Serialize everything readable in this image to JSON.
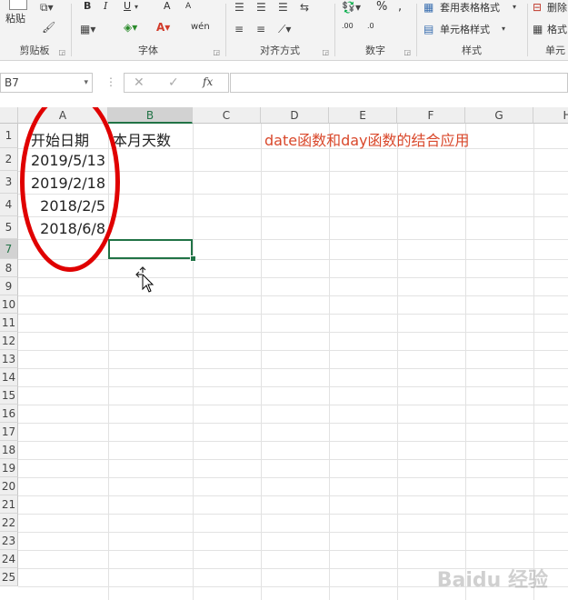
{
  "ribbon": {
    "clipboard": {
      "paste_label": "粘贴",
      "group_label": "剪贴板"
    },
    "font": {
      "bold": "B",
      "italic": "I",
      "underline": "U",
      "grow": "A",
      "shrink": "A",
      "wen": "wén",
      "group_label": "字体"
    },
    "alignment": {
      "group_label": "对齐方式"
    },
    "number": {
      "percent": "%",
      "comma": ",",
      "inc_decimal": ".00",
      "dec_decimal": ".0",
      "group_label": "数字"
    },
    "styles": {
      "table_format": "套用表格格式",
      "cell_styles": "单元格样式",
      "group_label": "样式"
    },
    "cells": {
      "delete_label": "删除",
      "format_label": "格式",
      "group_label": "单元"
    }
  },
  "formula_bar": {
    "name_box": "B7",
    "fx": "fx",
    "formula": ""
  },
  "columns": [
    "A",
    "B",
    "C",
    "D",
    "E",
    "F",
    "G",
    "H"
  ],
  "rows": [
    "1",
    "2",
    "3",
    "4",
    "5",
    "7",
    "8",
    "9",
    "10",
    "11",
    "12",
    "13",
    "14",
    "15",
    "16",
    "17",
    "18",
    "19",
    "20",
    "21",
    "22",
    "23",
    "24",
    "25"
  ],
  "cells": {
    "A1": "开始日期",
    "B1": "本月天数",
    "D1": "date函数和day函数的结合应用",
    "A2": "2019/5/13",
    "A3": "2019/2/18",
    "A4": "2018/2/5",
    "A5": "2018/6/8"
  },
  "colors": {
    "accent": "#217346",
    "annotation_red": "#e00000",
    "title_red": "#d9482b"
  },
  "watermark": "Baidu 经验"
}
